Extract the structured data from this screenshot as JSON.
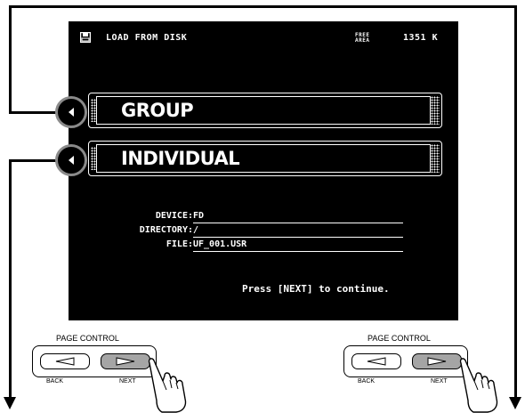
{
  "screen": {
    "title": "LOAD FROM DISK",
    "free_line1": "FREE",
    "free_line2": "AREA",
    "free_size": "1351 K",
    "items": [
      {
        "label": "GROUP"
      },
      {
        "label": "INDIVIDUAL"
      }
    ],
    "fields": {
      "device_label": "DEVICE:",
      "device_value": "FD",
      "directory_label": "DIRECTORY:",
      "directory_value": "/",
      "file_label": "FILE:",
      "file_value": "UF_001.USR"
    },
    "prompt": "Press [NEXT] to continue."
  },
  "page_control_left": {
    "title": "PAGE CONTROL",
    "back_label": "BACK",
    "next_label": "NEXT"
  },
  "page_control_right": {
    "title": "PAGE CONTROL",
    "back_label": "BACK",
    "next_label": "NEXT"
  },
  "icons": [
    "disk-icon",
    "left-triangle-icon",
    "down-arrow-icon",
    "pointing-hand-icon"
  ]
}
